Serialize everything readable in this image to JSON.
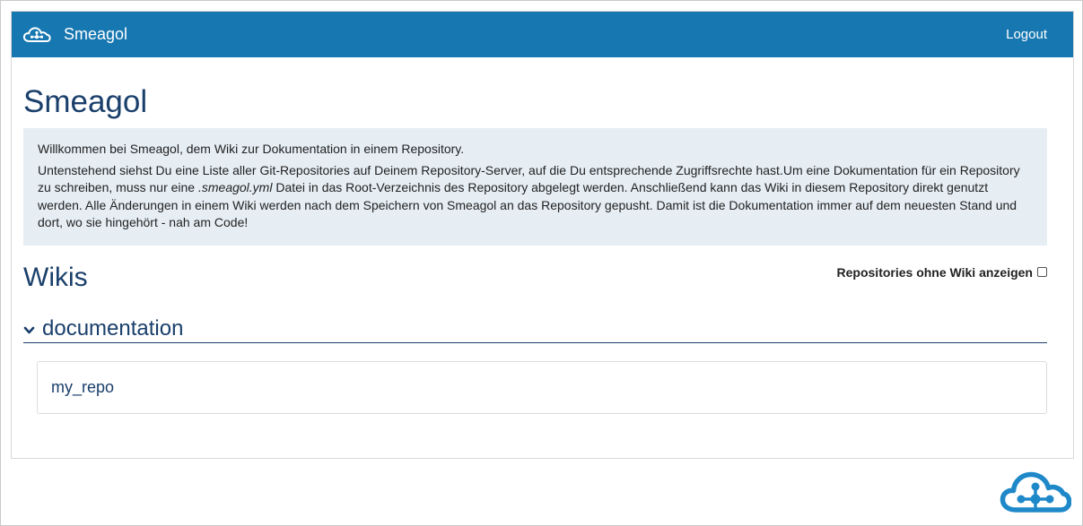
{
  "navbar": {
    "brand": "Smeagol",
    "logout_label": "Logout",
    "logo_icon": "cloud-network-icon",
    "color": "#1777b1"
  },
  "page": {
    "title": "Smeagol",
    "intro_p1": "Willkommen bei Smeagol, dem Wiki zur Dokumentation in einem Repository.",
    "intro_p2_before": "Untenstehend siehst Du eine Liste aller Git-Repositories auf Deinem Repository-Server, auf die Du entsprechende Zugriffsrechte hast.Um eine Dokumentation für ein Repository zu schreiben, muss nur eine ",
    "intro_p2_file": ".smeagol.yml",
    "intro_p2_after": " Datei in das Root-Verzeichnis des Repository abgelegt werden. Anschließend kann das Wiki in diesem Repository direkt genutzt werden. Alle Änderungen in einem Wiki werden nach dem Speichern von Smeagol an das Repository gepusht. Damit ist die Dokumentation immer auf dem neuesten Stand und dort, wo sie hingehört - nah am Code!"
  },
  "wikis": {
    "title": "Wikis",
    "toggle_label": "Repositories ohne Wiki anzeigen",
    "toggle_checked": false,
    "groups": [
      {
        "name": "documentation",
        "expanded": true,
        "repos": [
          {
            "name": "my_repo"
          }
        ]
      }
    ]
  },
  "footer": {
    "logo_icon": "cloud-network-icon",
    "color": "#1e88c9"
  }
}
